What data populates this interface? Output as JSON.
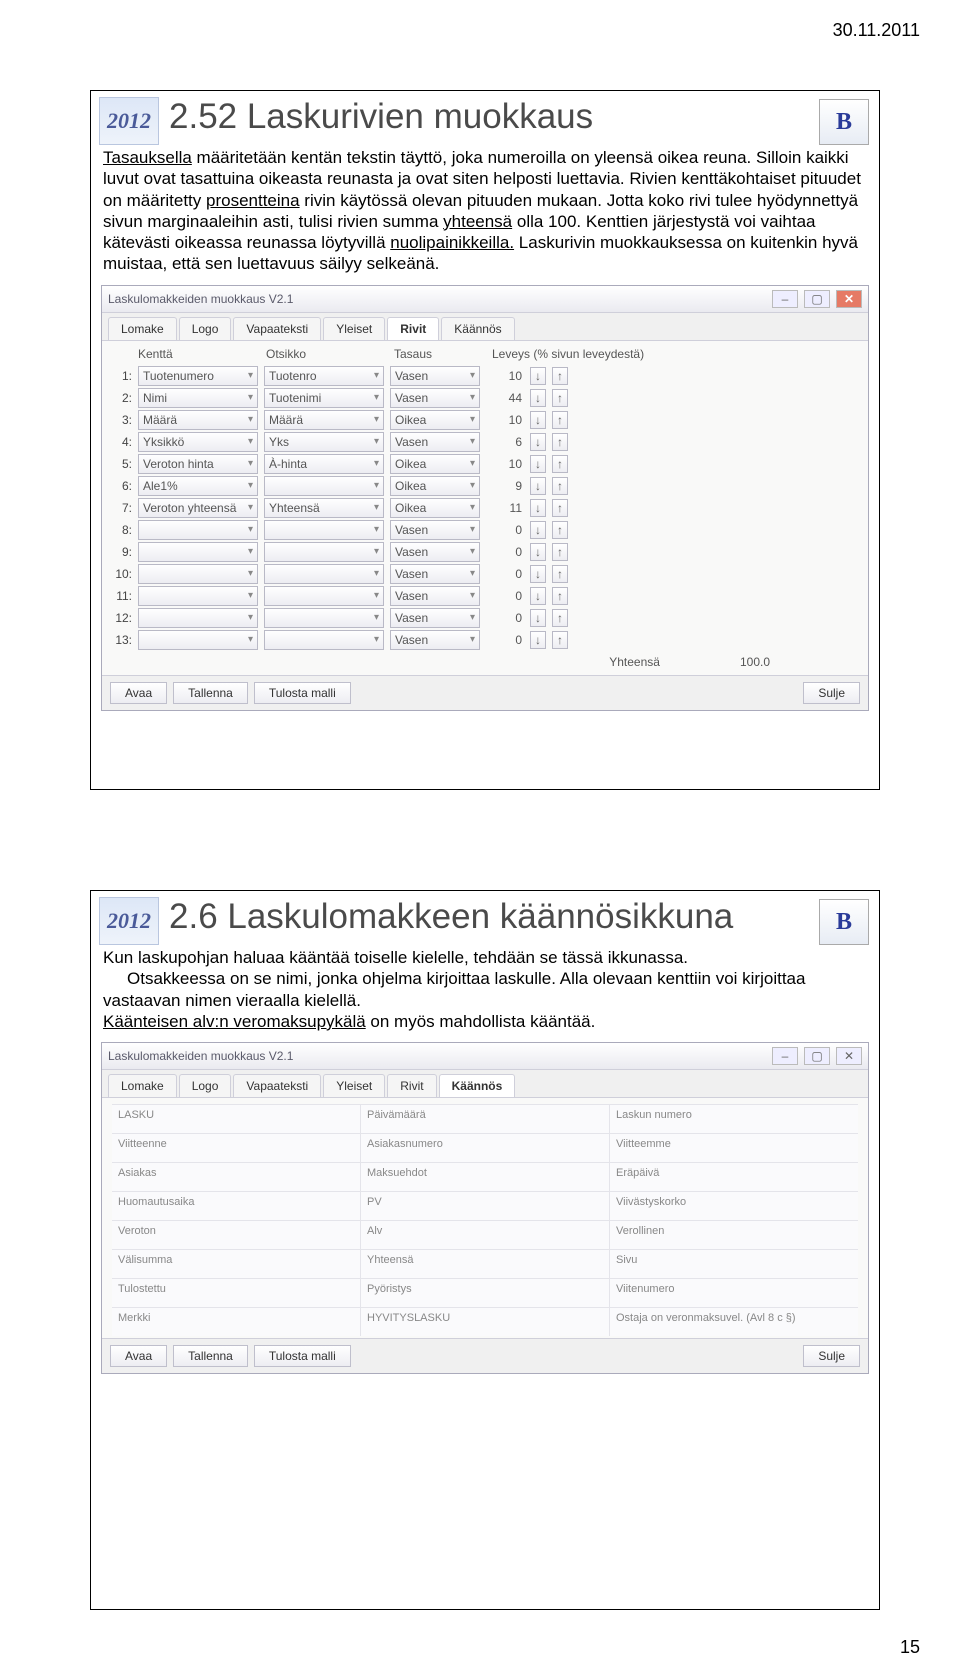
{
  "page_date": "30.11.2011",
  "page_number": "15",
  "logo_2012": "2012",
  "bankson_label": "B",
  "slide1": {
    "title": "2.52 Laskurivien muokkaus",
    "para": "Tasauksella määritetään kentän tekstin täyttö, joka numeroilla on yleensä oikea reuna. Silloin kaikki luvut ovat tasattuina oikeasta reunasta ja ovat siten helposti luettavia. Rivien kenttäkohtaiset pituudet on määritetty prosentteina rivin käytössä olevan pituuden mukaan. Jotta koko rivi tulee hyödynnettyä sivun marginaaleihin asti, tulisi rivien summa yhteensä olla 100. Kenttien järjestystä voi vaihtaa kätevästi oikeassa reunassa löytyvillä nuolipainikkeilla. Laskurivin muokkauksessa on kuitenkin hyvä muistaa, että sen luettavuus säilyy selkeänä.",
    "u1": "Tasauksella",
    "u2": "prosentteina",
    "u3": "yhteensä",
    "u4": "nuolipainikkeilla.",
    "window_title": "Laskulomakkeiden muokkaus V2.1",
    "tabs": [
      "Lomake",
      "Logo",
      "Vapaateksti",
      "Yleiset",
      "Rivit",
      "Käännös"
    ],
    "active_tab": "Rivit",
    "headers": {
      "field": "Kenttä",
      "title": "Otsikko",
      "align": "Tasaus",
      "width": "Leveys (% sivun leveydestä)"
    },
    "rows": [
      {
        "field": "Tuotenumero",
        "title": "Tuotenro",
        "align": "Vasen",
        "w": "10"
      },
      {
        "field": "Nimi",
        "title": "Tuotenimi",
        "align": "Vasen",
        "w": "44"
      },
      {
        "field": "Määrä",
        "title": "Määrä",
        "align": "Oikea",
        "w": "10"
      },
      {
        "field": "Yksikkö",
        "title": "Yks",
        "align": "Vasen",
        "w": "6"
      },
      {
        "field": "Veroton hinta",
        "title": "À-hinta",
        "align": "Oikea",
        "w": "10"
      },
      {
        "field": "Ale1%",
        "title": "",
        "align": "Oikea",
        "w": "9"
      },
      {
        "field": "Veroton yhteensä",
        "title": "Yhteensä",
        "align": "Oikea",
        "w": "11"
      },
      {
        "field": "",
        "title": "",
        "align": "Vasen",
        "w": "0"
      },
      {
        "field": "",
        "title": "",
        "align": "Vasen",
        "w": "0"
      },
      {
        "field": "",
        "title": "",
        "align": "Vasen",
        "w": "0"
      },
      {
        "field": "",
        "title": "",
        "align": "Vasen",
        "w": "0"
      },
      {
        "field": "",
        "title": "",
        "align": "Vasen",
        "w": "0"
      },
      {
        "field": "",
        "title": "",
        "align": "Vasen",
        "w": "0"
      }
    ],
    "total_label": "Yhteensä",
    "total_value": "100.0",
    "buttons": {
      "open": "Avaa",
      "save": "Tallenna",
      "print": "Tulosta malli",
      "close": "Sulje"
    }
  },
  "slide2": {
    "title": "2.6 Laskulomakkeen käännösikkuna",
    "para_lead": "Kun laskupohjan haluaa kääntää toiselle kielelle, tehdään se tässä ikkunassa.",
    "para_rest": "Otsakkeessa on se nimi, jonka ohjelma kirjoittaa laskulle. Alla olevaan kenttiin voi kirjoittaa vastaavan nimen vieraalla kielellä.",
    "para_u": "Käänteisen alv:n veromaksupykälä",
    "para_after_u": " on myös mahdollista kääntää.",
    "window_title": "Laskulomakkeiden muokkaus V2.1",
    "tabs": [
      "Lomake",
      "Logo",
      "Vapaateksti",
      "Yleiset",
      "Rivit",
      "Käännös"
    ],
    "active_tab": "Käännös",
    "trans_rows": [
      [
        "LASKU",
        "Päivämäärä",
        "Laskun numero"
      ],
      [
        "Viitteenne",
        "Asiakasnumero",
        "Viitteemme"
      ],
      [
        "Asiakas",
        "Maksuehdot",
        "Eräpäivä"
      ],
      [
        "Huomautusaika",
        "PV",
        "Viivästyskorko"
      ],
      [
        "Veroton",
        "Alv",
        "Verollinen"
      ],
      [
        "Välisumma",
        "Yhteensä",
        "Sivu"
      ],
      [
        "Tulostettu",
        "Pyöristys",
        "Viitenumero"
      ],
      [
        "Merkki",
        "HYVITYSLASKU",
        "Ostaja on veronmaksuvel. (Avl 8 c §)"
      ]
    ],
    "buttons": {
      "open": "Avaa",
      "save": "Tallenna",
      "print": "Tulosta malli",
      "close": "Sulje"
    }
  }
}
